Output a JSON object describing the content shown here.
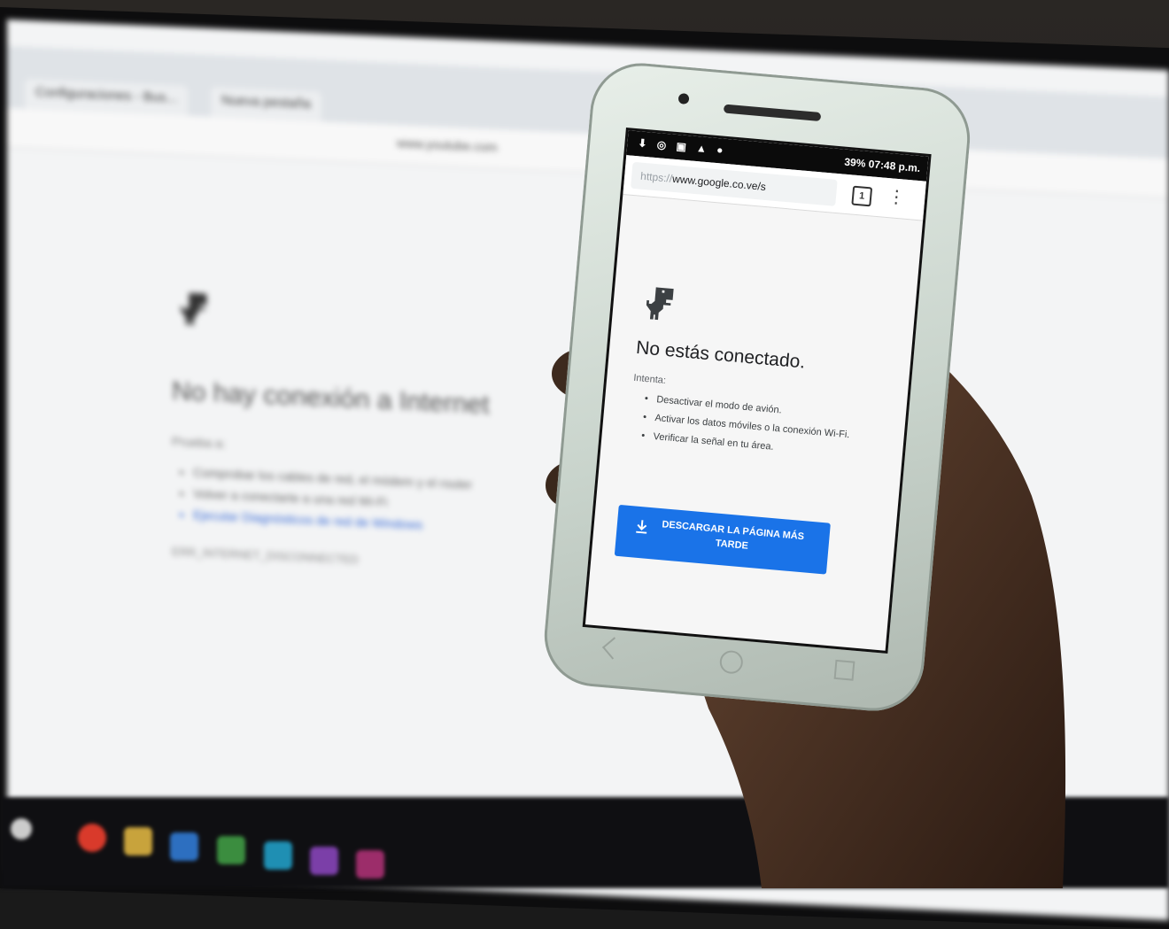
{
  "desktop": {
    "tabs": [
      "Configuraciones - Bus...",
      "Nueva pestaña"
    ],
    "url": "www.youtube.com",
    "heading": "No hay conexión a Internet",
    "subheading": "Prueba a:",
    "suggestions": [
      "Comprobar los cables de red, el módem y el router",
      "Volver a conectarte a una red Wi-Fi",
      "Ejecutar Diagnósticos de red de Windows"
    ],
    "error_code": "ERR_INTERNET_DISCONNECTED"
  },
  "phone": {
    "status": {
      "left_icons": "⬇ ◎ ▣ ▲ ●",
      "right": "39% 07:48 p.m."
    },
    "browser": {
      "url_scheme": "https://",
      "url_host": "www.google.co.ve/s",
      "tab_count": "1",
      "menu_icon": "⋮"
    },
    "offline_page": {
      "title": "No estás conectado.",
      "try_label": "Intenta:",
      "suggestions": [
        "Desactivar el modo de avión.",
        "Activar los datos móviles o la conexión Wi-Fi.",
        "Verificar la señal en tu área."
      ],
      "download_button": "DESCARGAR LA PÁGINA MÁS TARDE"
    }
  },
  "colors": {
    "accent_blue": "#1a73e8",
    "phone_shell": "#dfe7e1"
  }
}
